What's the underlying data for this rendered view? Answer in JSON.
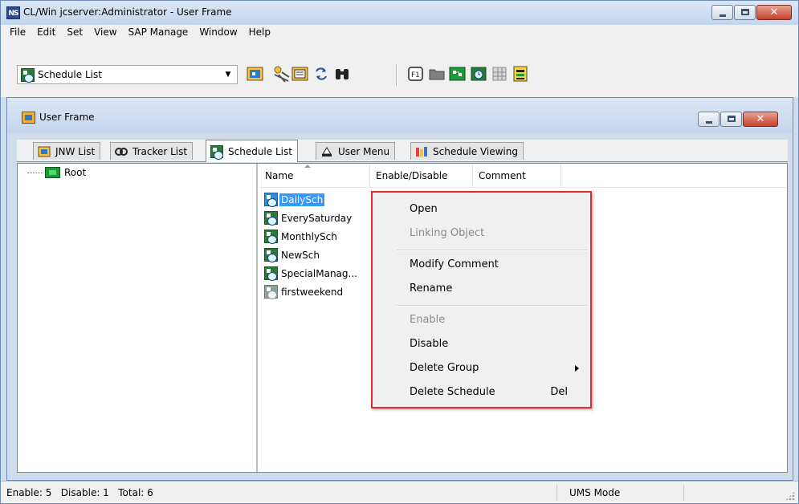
{
  "window": {
    "title": "CL/Win jcserver:Administrator - User Frame",
    "app_icon_text": "NS",
    "close_glyph": "✕",
    "buttons": [
      "minimize-icon",
      "maximize-icon",
      "close-icon"
    ]
  },
  "menubar": {
    "items": [
      "File",
      "Edit",
      "Set",
      "View",
      "SAP Manage",
      "Window",
      "Help"
    ]
  },
  "toolbar": {
    "combo_value": "Schedule List",
    "combo_arrow": "▼",
    "icons": [
      "job-network-icon",
      "tracker-icon",
      "schedule-icon",
      "refresh-icon",
      "binoculars-icon",
      "f1-help-icon",
      "folder-icon",
      "group-icon",
      "calendar-icon",
      "grid-icon",
      "database-icon"
    ]
  },
  "child": {
    "title": "User Frame",
    "close_glyph": "✕",
    "tabs": [
      {
        "label": "JNW List",
        "icon": "jnw-icon",
        "active": false
      },
      {
        "label": "Tracker List",
        "icon": "tracker-icon",
        "active": false
      },
      {
        "label": "Schedule List",
        "icon": "schedule-icon",
        "active": true
      },
      {
        "label": "User Menu",
        "icon": "user-menu-icon",
        "active": false
      },
      {
        "label": "Schedule Viewing",
        "icon": "schedule-viewing-icon",
        "active": false
      }
    ]
  },
  "tree": {
    "root_label": "Root"
  },
  "list": {
    "columns": [
      "Name",
      "Enable/Disable",
      "Comment"
    ],
    "rows": [
      {
        "name": "DailySch",
        "selected": true,
        "enabled": true
      },
      {
        "name": "EverySaturday",
        "selected": false,
        "enabled": true
      },
      {
        "name": "MonthlySch",
        "selected": false,
        "enabled": true
      },
      {
        "name": "NewSch",
        "selected": false,
        "enabled": true
      },
      {
        "name": "SpecialManag...",
        "selected": false,
        "enabled": true
      },
      {
        "name": "firstweekend",
        "selected": false,
        "enabled": false
      }
    ]
  },
  "context_menu": {
    "border_color": "#e42b2b",
    "items": [
      {
        "label": "Open",
        "disabled": false
      },
      {
        "label": "Linking Object",
        "disabled": true
      },
      {
        "label": "Modify Comment",
        "disabled": false
      },
      {
        "label": "Rename",
        "disabled": false
      },
      {
        "label": "Enable",
        "disabled": true
      },
      {
        "label": "Disable",
        "disabled": false
      },
      {
        "label": "Delete Group",
        "disabled": false,
        "submenu": true
      },
      {
        "label": "Delete Schedule",
        "disabled": false,
        "shortcut": "Del"
      }
    ]
  },
  "statusbar": {
    "counts": "Enable: 5   Disable: 1   Total: 6",
    "mode": "UMS Mode"
  },
  "colors": {
    "titlebar": "#c4d5ec",
    "selection": "#3399ff",
    "highlight_box": "#e42b2b"
  }
}
